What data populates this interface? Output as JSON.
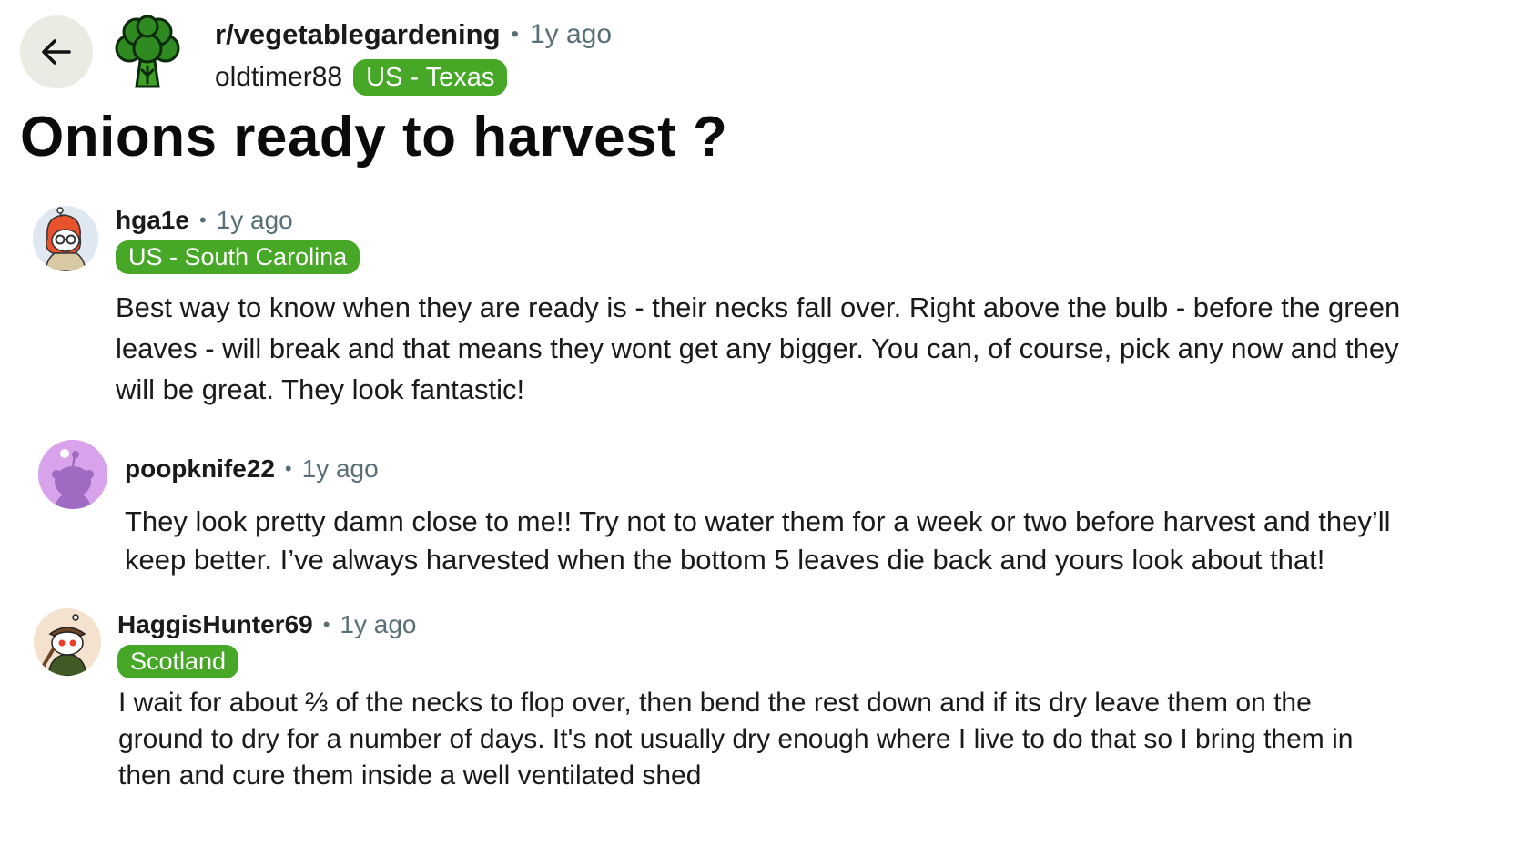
{
  "post": {
    "subreddit": "r/vegetablegardening",
    "time": "1y ago",
    "author": "oldtimer88",
    "author_flair": "US - Texas",
    "title": "Onions ready to harvest ?",
    "separator": "•"
  },
  "icons": {
    "back": "back-arrow-icon",
    "subreddit": "broccoli-icon"
  },
  "colors": {
    "flair_bg": "#46a826",
    "back_button_bg": "#e9ece3",
    "meta_text": "#576f76"
  },
  "comments": [
    {
      "user": "hga1e",
      "time": "1y ago",
      "flair": "US - South Carolina",
      "body": "Best way to know when they are ready is - their necks fall over. Right above the bulb - before the green leaves - will break and that means they wont get any bigger. You can, of course, pick any now and they will be great. They look fantastic!"
    },
    {
      "user": "poopknife22",
      "time": "1y ago",
      "body": "They look pretty damn close to me!! Try not to water them for a week or two before harvest and they’ll keep better. I’ve always harvested when the bottom 5 leaves die back and yours look about that!"
    },
    {
      "user": "HaggisHunter69",
      "time": "1y ago",
      "flair": "Scotland",
      "body": "I wait for about ⅔ of the necks to flop over, then bend the rest down and if its dry leave them on the ground to dry for a number of days. It's not usually dry enough where I live to do that so I bring them in then and cure them inside a well ventilated shed"
    }
  ]
}
